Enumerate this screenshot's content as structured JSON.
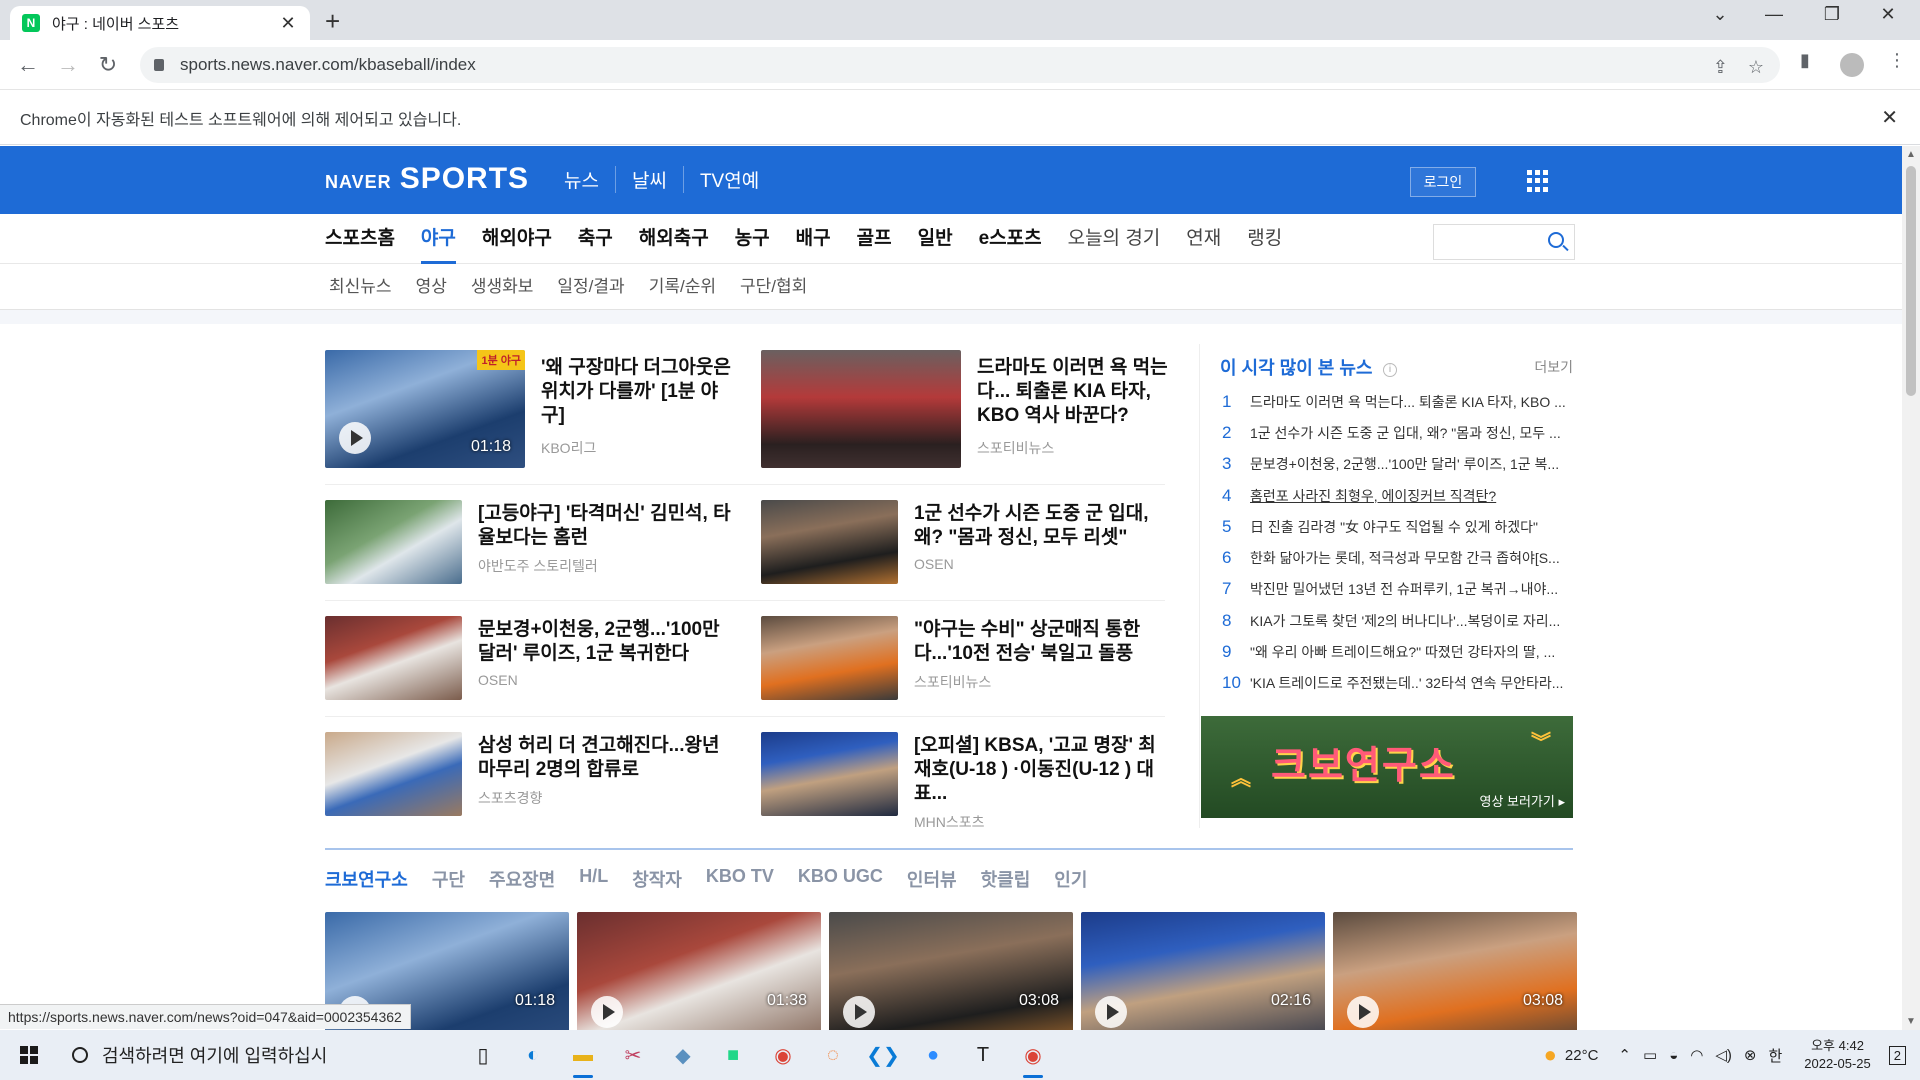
{
  "browser": {
    "tab_title": "야구 : 네이버 스포츠",
    "tab_favicon": "N",
    "url": "sports.news.naver.com/kbaseball/index",
    "infobar": "Chrome이 자동화된 테스트 소프트웨어에 의해 제어되고 있습니다.",
    "status_url": "https://sports.news.naver.com/news?oid=047&aid=0002354362"
  },
  "header": {
    "logo_naver": "NAVER",
    "logo_sports": "SPORTS",
    "top_menu": [
      "뉴스",
      "날씨",
      "TV연예"
    ],
    "login": "로그인"
  },
  "main_nav": [
    "스포츠홈",
    "야구",
    "해외야구",
    "축구",
    "해외축구",
    "농구",
    "배구",
    "골프",
    "일반",
    "e스포츠",
    "오늘의 경기",
    "연재",
    "랭킹"
  ],
  "sub_nav": [
    "최신뉴스",
    "영상",
    "생생화보",
    "일정/결과",
    "기록/순위",
    "구단/협회"
  ],
  "articles": [
    {
      "title": "'왜 구장마다 더그아웃은 위치가 다를까' [1분 야구]",
      "source": "KBO리그",
      "duration": "01:18",
      "tag": "1분 야구"
    },
    {
      "title": "드라마도 이러면 욕 먹는다... 퇴출론 KIA 타자, KBO 역사 바꾼다?",
      "source": "스포티비뉴스"
    },
    {
      "title": "[고등야구] '타격머신' 김민석, 타율보다는 홈런",
      "source": "야반도주 스토리텔러"
    },
    {
      "title": "1군 선수가 시즌 도중 군 입대, 왜? \"몸과 정신, 모두 리셋\"",
      "source": "OSEN"
    },
    {
      "title": "문보경+이천웅, 2군행...'100만 달러' 루이즈, 1군 복귀한다",
      "source": "OSEN"
    },
    {
      "title": "\"야구는 수비\" 상군매직 통한다...'10전 전승' 북일고 돌풍",
      "source": "스포티비뉴스"
    },
    {
      "title": "삼성 허리 더 견고해진다...왕년 마무리 2명의 합류로",
      "source": "스포츠경향"
    },
    {
      "title": "[오피셜] KBSA, '고교 명장' 최재호(U-18 ) ·이동진(U-12 ) 대표...",
      "source": "MHN스포츠"
    }
  ],
  "ranking": {
    "title": "이 시각 많이 본 뉴스",
    "info": "i",
    "more": "더보기",
    "items": [
      {
        "num": "1",
        "text": "드라마도 이러면 욕 먹는다... 퇴출론 KIA 타자, KBO ..."
      },
      {
        "num": "2",
        "text": "1군 선수가 시즌 도중 군 입대, 왜? \"몸과 정신, 모두 ..."
      },
      {
        "num": "3",
        "text": "문보경+이천웅, 2군행...'100만 달러' 루이즈, 1군 복..."
      },
      {
        "num": "4",
        "text": "홈런포 사라진 최형우, 에이징커브 직격탄?"
      },
      {
        "num": "5",
        "text": "日 진출 김라경 \"女 야구도 직업될 수 있게 하겠다\""
      },
      {
        "num": "6",
        "text": "한화 닮아가는 롯데, 적극성과 무모함 간극 좁혀야[S..."
      },
      {
        "num": "7",
        "text": "박진만 밀어냈던 13년 전 슈퍼루키, 1군 복귀→내야..."
      },
      {
        "num": "8",
        "text": "KIA가 그토록 찾던 '제2의 버나디나'...복덩이로 자리..."
      },
      {
        "num": "9",
        "text": "\"왜 우리 아빠 트레이드해요?\" 따졌던 강타자의 딸, ..."
      },
      {
        "num": "10",
        "text": "'KIA 트레이드로 주전됐는데..' 32타석 연속 무안타라..."
      }
    ]
  },
  "banner": {
    "title": "크보연구소",
    "link": "영상 보러가기 ▸"
  },
  "video_tabs": [
    "크보연구소",
    "구단",
    "주요장면",
    "H/L",
    "창작자",
    "KBO TV",
    "KBO UGC",
    "인터뷰",
    "핫클립",
    "인기"
  ],
  "videos": [
    {
      "duration": "01:18"
    },
    {
      "duration": "01:38"
    },
    {
      "duration": "03:08"
    },
    {
      "duration": "02:16"
    },
    {
      "duration": "03:08"
    }
  ],
  "taskbar": {
    "search_placeholder": "검색하려면 여기에 입력하십시",
    "weather": "22°C",
    "ime": "한",
    "time": "오후 4:42",
    "date": "2022-05-25",
    "notifications": "2"
  }
}
